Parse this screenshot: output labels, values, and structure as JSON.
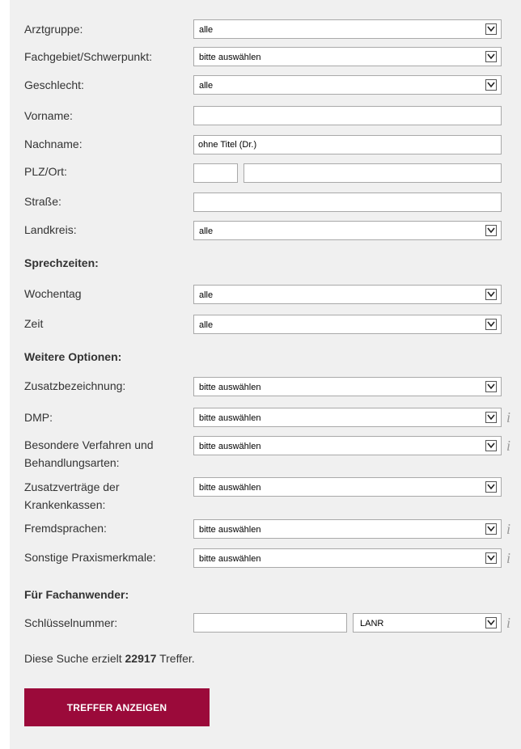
{
  "form": {
    "arztgruppe": {
      "label": "Arztgruppe:",
      "value": "alle"
    },
    "fachgebiet": {
      "label": "Fachgebiet/Schwerpunkt:",
      "value": "bitte auswählen"
    },
    "geschlecht": {
      "label": "Geschlecht:",
      "value": "alle"
    },
    "vorname": {
      "label": "Vorname:",
      "value": ""
    },
    "nachname": {
      "label": "Nachname:",
      "value": "ohne Titel (Dr.)"
    },
    "plzort": {
      "label": "PLZ/Ort:",
      "plz": "",
      "ort": ""
    },
    "strasse": {
      "label": "Straße:",
      "value": ""
    },
    "landkreis": {
      "label": "Landkreis:",
      "value": "alle"
    }
  },
  "sprechzeiten": {
    "heading": "Sprechzeiten:",
    "wochentag": {
      "label": "Wochentag",
      "value": "alle"
    },
    "zeit": {
      "label": "Zeit",
      "value": "alle"
    }
  },
  "optionen": {
    "heading": "Weitere Optionen:",
    "zusatz": {
      "label": "Zusatzbezeichnung:",
      "value": "bitte auswählen"
    },
    "dmp": {
      "label": "DMP:",
      "value": "bitte auswählen"
    },
    "besondere": {
      "label_line1": "Besondere Verfahren und",
      "label_line2": "Behandlungsarten:",
      "value": "bitte auswählen"
    },
    "zusatzvertraege": {
      "label_line1": "Zusatzverträge der",
      "label_line2": "Krankenkassen:",
      "value": "bitte auswählen"
    },
    "fremdsprachen": {
      "label": "Fremdsprachen:",
      "value": "bitte auswählen"
    },
    "sonstige": {
      "label": "Sonstige Praxismerkmale:",
      "value": "bitte auswählen"
    }
  },
  "fachanwender": {
    "heading": "Für Fachanwender:",
    "schluessel": {
      "label": "Schlüsselnummer:",
      "value": "",
      "type_value": "LANR"
    }
  },
  "result": {
    "prefix": "Diese Suche erzielt ",
    "count": "22917",
    "suffix": " Treffer."
  },
  "button": {
    "label": "TREFFER ANZEIGEN"
  },
  "info_glyph": "i",
  "colors": {
    "panel": "#f0f0f0",
    "button": "#9b0a3a",
    "info": "#9a9a9a"
  }
}
